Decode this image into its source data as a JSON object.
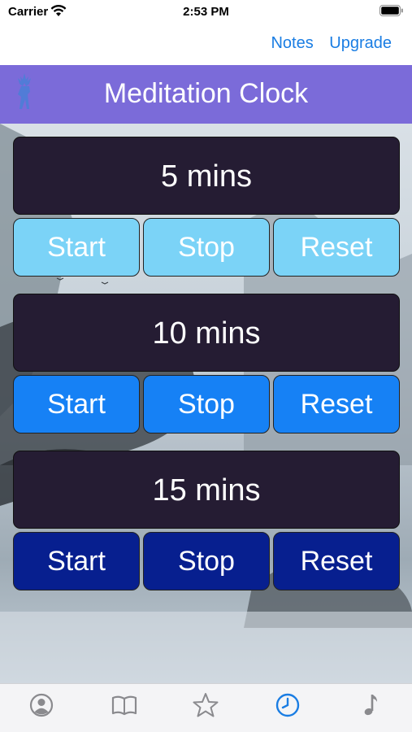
{
  "status_bar": {
    "carrier": "Carrier",
    "time": "2:53 PM"
  },
  "nav": {
    "notes": "Notes",
    "upgrade": "Upgrade"
  },
  "header": {
    "title": "Meditation Clock"
  },
  "colors": {
    "header": "#7b6bd9",
    "timer_bg": "#251c33",
    "group1_buttons": "#7bd3f7",
    "group2_buttons": "#1681f5",
    "group3_buttons": "#071f8f",
    "tab_active": "#1a7de3",
    "tab_inactive": "#8a8a8e"
  },
  "timers": [
    {
      "label": "5 mins",
      "start": "Start",
      "stop": "Stop",
      "reset": "Reset"
    },
    {
      "label": "10 mins",
      "start": "Start",
      "stop": "Stop",
      "reset": "Reset"
    },
    {
      "label": "15 mins",
      "start": "Start",
      "stop": "Stop",
      "reset": "Reset"
    }
  ],
  "tabs": [
    {
      "icon": "profile-icon",
      "active": false
    },
    {
      "icon": "book-icon",
      "active": false
    },
    {
      "icon": "star-icon",
      "active": false
    },
    {
      "icon": "clock-icon",
      "active": true
    },
    {
      "icon": "music-note-icon",
      "active": false
    }
  ]
}
